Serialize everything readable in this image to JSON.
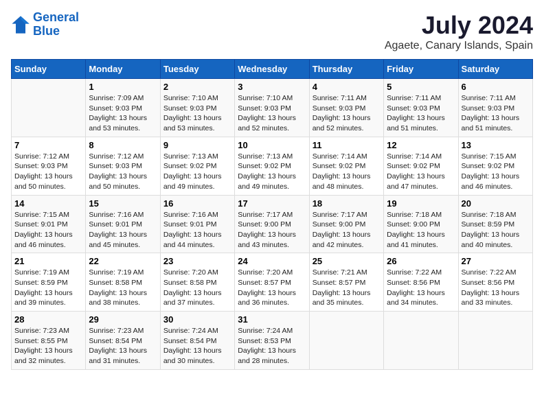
{
  "header": {
    "logo_line1": "General",
    "logo_line2": "Blue",
    "month_title": "July 2024",
    "location": "Agaete, Canary Islands, Spain"
  },
  "weekdays": [
    "Sunday",
    "Monday",
    "Tuesday",
    "Wednesday",
    "Thursday",
    "Friday",
    "Saturday"
  ],
  "weeks": [
    [
      {
        "day": "",
        "info": ""
      },
      {
        "day": "1",
        "info": "Sunrise: 7:09 AM\nSunset: 9:03 PM\nDaylight: 13 hours\nand 53 minutes."
      },
      {
        "day": "2",
        "info": "Sunrise: 7:10 AM\nSunset: 9:03 PM\nDaylight: 13 hours\nand 53 minutes."
      },
      {
        "day": "3",
        "info": "Sunrise: 7:10 AM\nSunset: 9:03 PM\nDaylight: 13 hours\nand 52 minutes."
      },
      {
        "day": "4",
        "info": "Sunrise: 7:11 AM\nSunset: 9:03 PM\nDaylight: 13 hours\nand 52 minutes."
      },
      {
        "day": "5",
        "info": "Sunrise: 7:11 AM\nSunset: 9:03 PM\nDaylight: 13 hours\nand 51 minutes."
      },
      {
        "day": "6",
        "info": "Sunrise: 7:11 AM\nSunset: 9:03 PM\nDaylight: 13 hours\nand 51 minutes."
      }
    ],
    [
      {
        "day": "7",
        "info": "Sunrise: 7:12 AM\nSunset: 9:03 PM\nDaylight: 13 hours\nand 50 minutes."
      },
      {
        "day": "8",
        "info": "Sunrise: 7:12 AM\nSunset: 9:03 PM\nDaylight: 13 hours\nand 50 minutes."
      },
      {
        "day": "9",
        "info": "Sunrise: 7:13 AM\nSunset: 9:02 PM\nDaylight: 13 hours\nand 49 minutes."
      },
      {
        "day": "10",
        "info": "Sunrise: 7:13 AM\nSunset: 9:02 PM\nDaylight: 13 hours\nand 49 minutes."
      },
      {
        "day": "11",
        "info": "Sunrise: 7:14 AM\nSunset: 9:02 PM\nDaylight: 13 hours\nand 48 minutes."
      },
      {
        "day": "12",
        "info": "Sunrise: 7:14 AM\nSunset: 9:02 PM\nDaylight: 13 hours\nand 47 minutes."
      },
      {
        "day": "13",
        "info": "Sunrise: 7:15 AM\nSunset: 9:02 PM\nDaylight: 13 hours\nand 46 minutes."
      }
    ],
    [
      {
        "day": "14",
        "info": "Sunrise: 7:15 AM\nSunset: 9:01 PM\nDaylight: 13 hours\nand 46 minutes."
      },
      {
        "day": "15",
        "info": "Sunrise: 7:16 AM\nSunset: 9:01 PM\nDaylight: 13 hours\nand 45 minutes."
      },
      {
        "day": "16",
        "info": "Sunrise: 7:16 AM\nSunset: 9:01 PM\nDaylight: 13 hours\nand 44 minutes."
      },
      {
        "day": "17",
        "info": "Sunrise: 7:17 AM\nSunset: 9:00 PM\nDaylight: 13 hours\nand 43 minutes."
      },
      {
        "day": "18",
        "info": "Sunrise: 7:17 AM\nSunset: 9:00 PM\nDaylight: 13 hours\nand 42 minutes."
      },
      {
        "day": "19",
        "info": "Sunrise: 7:18 AM\nSunset: 9:00 PM\nDaylight: 13 hours\nand 41 minutes."
      },
      {
        "day": "20",
        "info": "Sunrise: 7:18 AM\nSunset: 8:59 PM\nDaylight: 13 hours\nand 40 minutes."
      }
    ],
    [
      {
        "day": "21",
        "info": "Sunrise: 7:19 AM\nSunset: 8:59 PM\nDaylight: 13 hours\nand 39 minutes."
      },
      {
        "day": "22",
        "info": "Sunrise: 7:19 AM\nSunset: 8:58 PM\nDaylight: 13 hours\nand 38 minutes."
      },
      {
        "day": "23",
        "info": "Sunrise: 7:20 AM\nSunset: 8:58 PM\nDaylight: 13 hours\nand 37 minutes."
      },
      {
        "day": "24",
        "info": "Sunrise: 7:20 AM\nSunset: 8:57 PM\nDaylight: 13 hours\nand 36 minutes."
      },
      {
        "day": "25",
        "info": "Sunrise: 7:21 AM\nSunset: 8:57 PM\nDaylight: 13 hours\nand 35 minutes."
      },
      {
        "day": "26",
        "info": "Sunrise: 7:22 AM\nSunset: 8:56 PM\nDaylight: 13 hours\nand 34 minutes."
      },
      {
        "day": "27",
        "info": "Sunrise: 7:22 AM\nSunset: 8:56 PM\nDaylight: 13 hours\nand 33 minutes."
      }
    ],
    [
      {
        "day": "28",
        "info": "Sunrise: 7:23 AM\nSunset: 8:55 PM\nDaylight: 13 hours\nand 32 minutes."
      },
      {
        "day": "29",
        "info": "Sunrise: 7:23 AM\nSunset: 8:54 PM\nDaylight: 13 hours\nand 31 minutes."
      },
      {
        "day": "30",
        "info": "Sunrise: 7:24 AM\nSunset: 8:54 PM\nDaylight: 13 hours\nand 30 minutes."
      },
      {
        "day": "31",
        "info": "Sunrise: 7:24 AM\nSunset: 8:53 PM\nDaylight: 13 hours\nand 28 minutes."
      },
      {
        "day": "",
        "info": ""
      },
      {
        "day": "",
        "info": ""
      },
      {
        "day": "",
        "info": ""
      }
    ]
  ]
}
